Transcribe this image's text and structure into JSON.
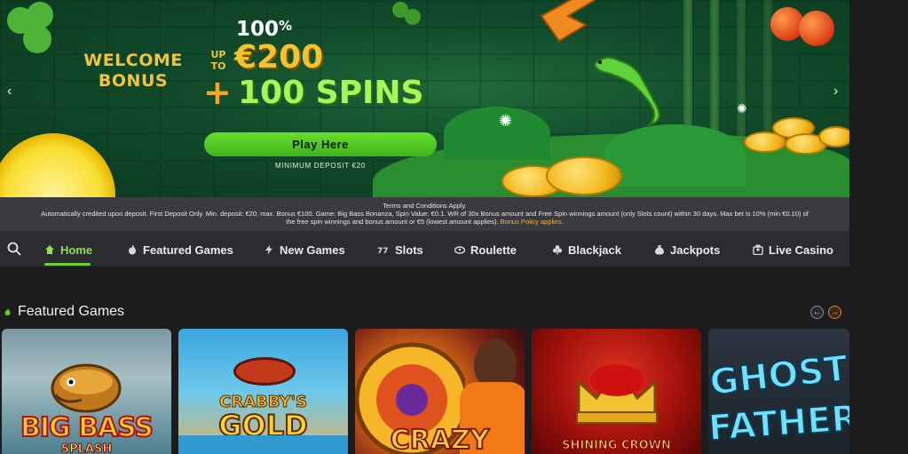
{
  "hero": {
    "welcome_line1": "WELCOME",
    "welcome_line2": "BONUS",
    "percent_value": "100",
    "percent_symbol": "%",
    "up_to_line1": "UP",
    "up_to_line2": "TO",
    "amount": "€200",
    "plus": "+",
    "spins": "100 SPINS",
    "cta_label": "Play Here",
    "min_deposit": "MINIMUM DEPOSIT €20",
    "prev_arrow": "‹",
    "next_arrow": "›"
  },
  "terms": {
    "heading": "Terms and Conditions Apply.",
    "body_line1": "Automatically credited upon deposit. First Deposit Only. Min. deposit: €20, max. Bonus €100. Game: Big Bass Bonanza, Spin Value: €0.1. WR of 30x Bonus amount and Free Spin winnings amount (only Slots count) within 30 days. Max bet is 10% (min €0.10) of",
    "body_line2": "the free spin winnings and bonus amount or €5 (lowest amount applies).",
    "link": "Bonus Policy applies."
  },
  "nav": {
    "items": [
      {
        "label": "Home",
        "icon": "home-icon"
      },
      {
        "label": "Featured Games",
        "icon": "flame-icon"
      },
      {
        "label": "New Games",
        "icon": "lightning-icon"
      },
      {
        "label": "Slots",
        "icon": "slots-777-icon"
      },
      {
        "label": "Roulette",
        "icon": "roulette-icon"
      },
      {
        "label": "Blackjack",
        "icon": "club-icon"
      },
      {
        "label": "Jackpots",
        "icon": "money-bag-icon"
      },
      {
        "label": "Live Casino",
        "icon": "live-dealer-icon"
      }
    ],
    "active": "Home"
  },
  "featured": {
    "title": "Featured Games",
    "prev": "←",
    "next": "→",
    "games": [
      {
        "line1": "BIG BASS",
        "line2": "SPLASH"
      },
      {
        "line1": "CRABBY'S",
        "line2": "GOLD"
      },
      {
        "line1": "CRAZY",
        "line2": ""
      },
      {
        "line1": "SHINING CROWN",
        "line2": ""
      },
      {
        "line1": "GHOST",
        "line2": "FATHER"
      }
    ]
  },
  "colors": {
    "accent_green": "#6cd02c",
    "gold": "#f3c230",
    "nav_bg": "#2b2c30",
    "page_bg": "#1c1c1e"
  }
}
